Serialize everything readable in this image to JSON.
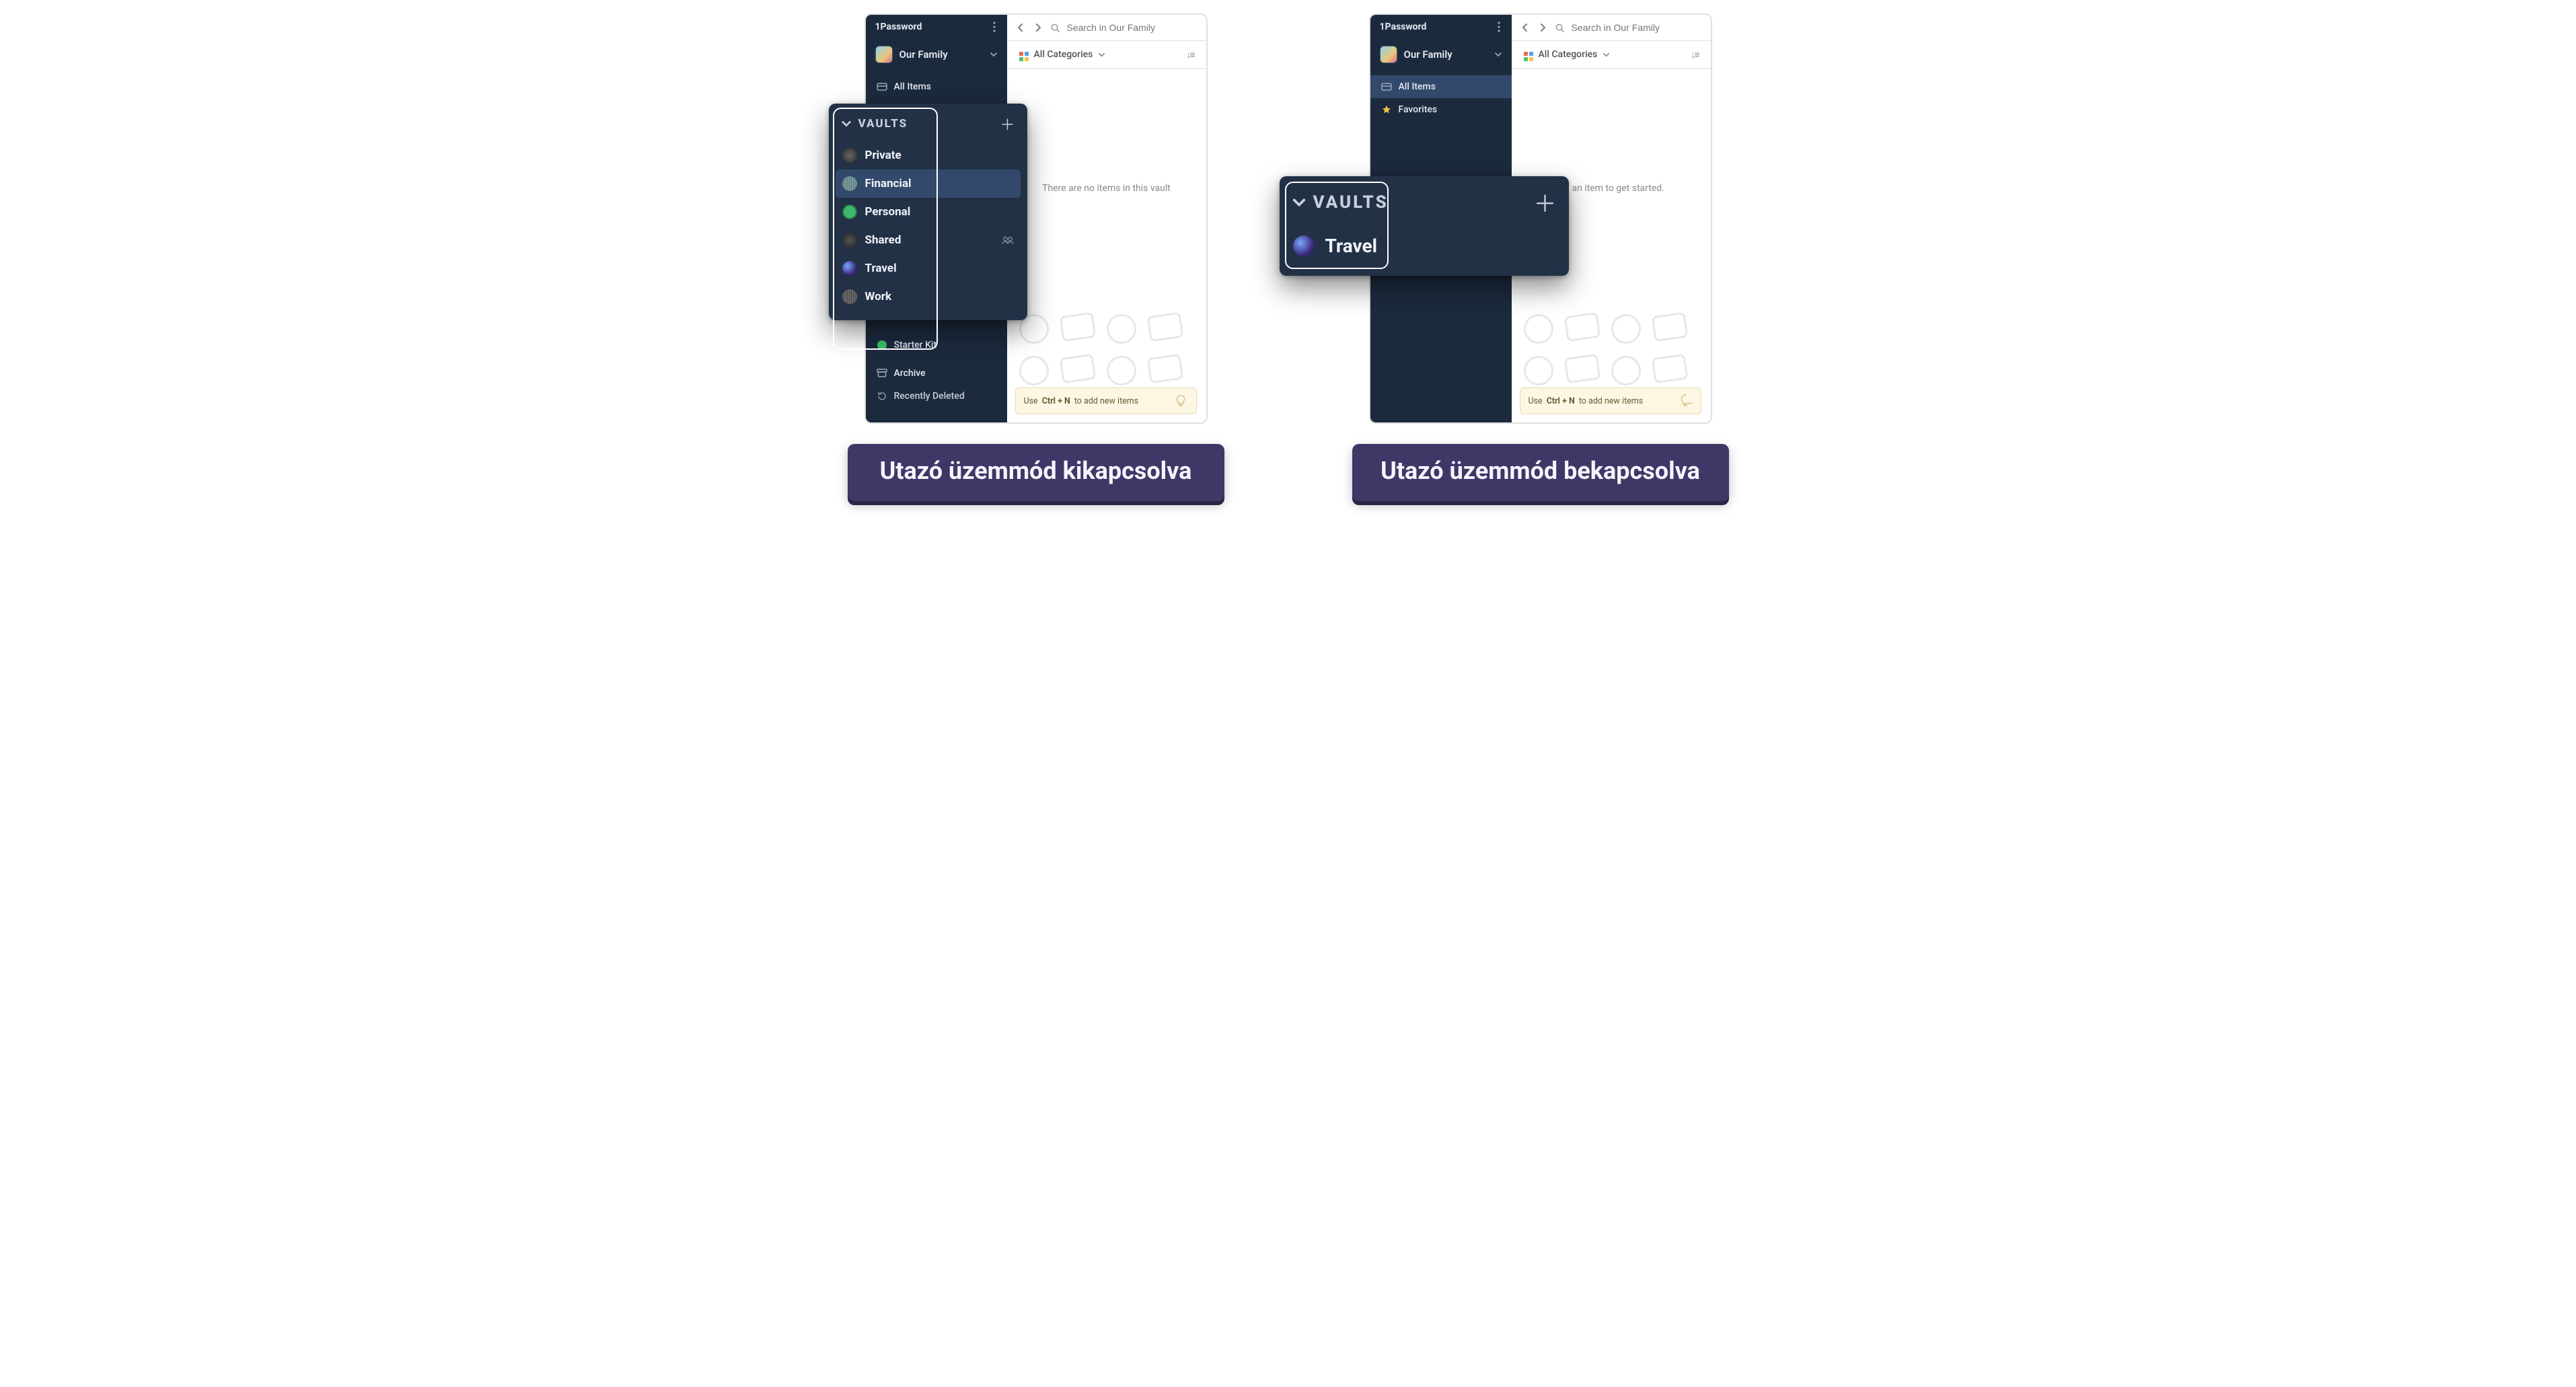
{
  "app_name": "1Password",
  "account": {
    "name": "Our Family"
  },
  "search": {
    "placeholder": "Search in Our Family"
  },
  "filter": {
    "label": "All Categories"
  },
  "sidebar_items": {
    "all_items": "All Items",
    "favorites": "Favorites",
    "starter_kit": "Starter Kit",
    "archive": "Archive",
    "recently_deleted": "Recently Deleted"
  },
  "vaults": {
    "header": "VAULTS",
    "items": [
      {
        "name": "Private"
      },
      {
        "name": "Financial"
      },
      {
        "name": "Personal"
      },
      {
        "name": "Shared"
      },
      {
        "name": "Travel"
      },
      {
        "name": "Work"
      }
    ],
    "travel_only": {
      "name": "Travel"
    }
  },
  "empty": {
    "left": "There are no items in this vault",
    "right_suffix": "an item to get started."
  },
  "tip": {
    "pre": "Use ",
    "key": "Ctrl + N",
    "post": " to add new items"
  },
  "captions": {
    "left": "Utazó üzemmód kikapcsolva",
    "right": "Utazó üzemmód bekapcsolva"
  }
}
